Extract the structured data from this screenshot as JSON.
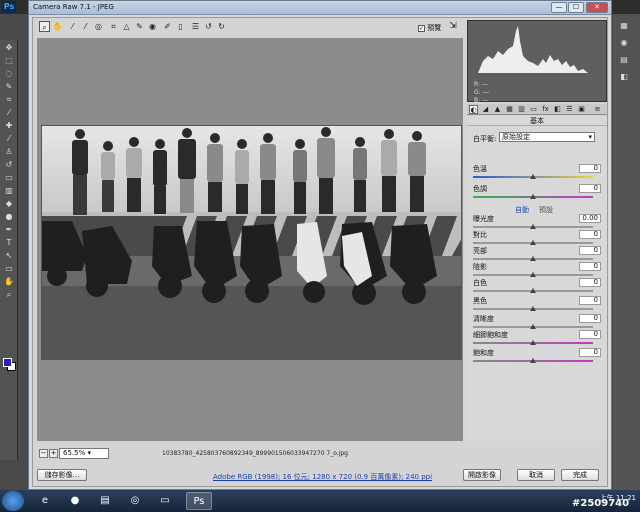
{
  "dialog": {
    "title": "Camera Raw 7.1 - JPEG",
    "close_label": "✕",
    "minimize_label": "—",
    "maximize_label": "☐"
  },
  "toolbar": {
    "preview_label": "預覽",
    "preview_checked": "✓"
  },
  "zoom": {
    "minus": "−",
    "plus": "+",
    "value": "65.5%"
  },
  "filename": "10383780_425803760892349_899901506033947270 7_o.jpg",
  "histogram": {
    "r_label": "R: ---",
    "g_label": "G: ---",
    "b_label": "B: ---"
  },
  "panel": {
    "title": "基本",
    "white_balance_label": "白平衡:",
    "white_balance_value": "原始設定",
    "auto_label": "自動",
    "default_label": "預設",
    "sliders": [
      {
        "label": "色溫",
        "value": "0",
        "level": 0.5
      },
      {
        "label": "色調",
        "value": "0",
        "level": 0.5
      },
      {
        "label": "曝光度",
        "value": "0.00",
        "level": 0.5
      },
      {
        "label": "對比",
        "value": "0",
        "level": 0.5
      },
      {
        "label": "亮部",
        "value": "0",
        "level": 0.5
      },
      {
        "label": "陰影",
        "value": "0",
        "level": 0.5
      },
      {
        "label": "白色",
        "value": "0",
        "level": 0.5
      },
      {
        "label": "黑色",
        "value": "0",
        "level": 0.5
      },
      {
        "label": "清晰度",
        "value": "0",
        "level": 0.5
      },
      {
        "label": "細節飽和度",
        "value": "0",
        "level": 0.5
      },
      {
        "label": "飽和度",
        "value": "0",
        "level": 0.5
      }
    ]
  },
  "bottom": {
    "save_label": "儲存影像...",
    "workflow_link": "Adobe RGB (1998); 16 位元; 1280 x 720 (0.9 百萬像素); 240 ppi",
    "open_label": "開啟影像",
    "cancel_label": "取消",
    "done_label": "完成"
  },
  "taskbar": {
    "time": "上午 11:21",
    "ps_label": "Ps"
  },
  "watermark": "#2509740",
  "colors": {
    "foreground": "#2a1fb8",
    "background": "#ffffff",
    "link": "#1a3fb0"
  }
}
